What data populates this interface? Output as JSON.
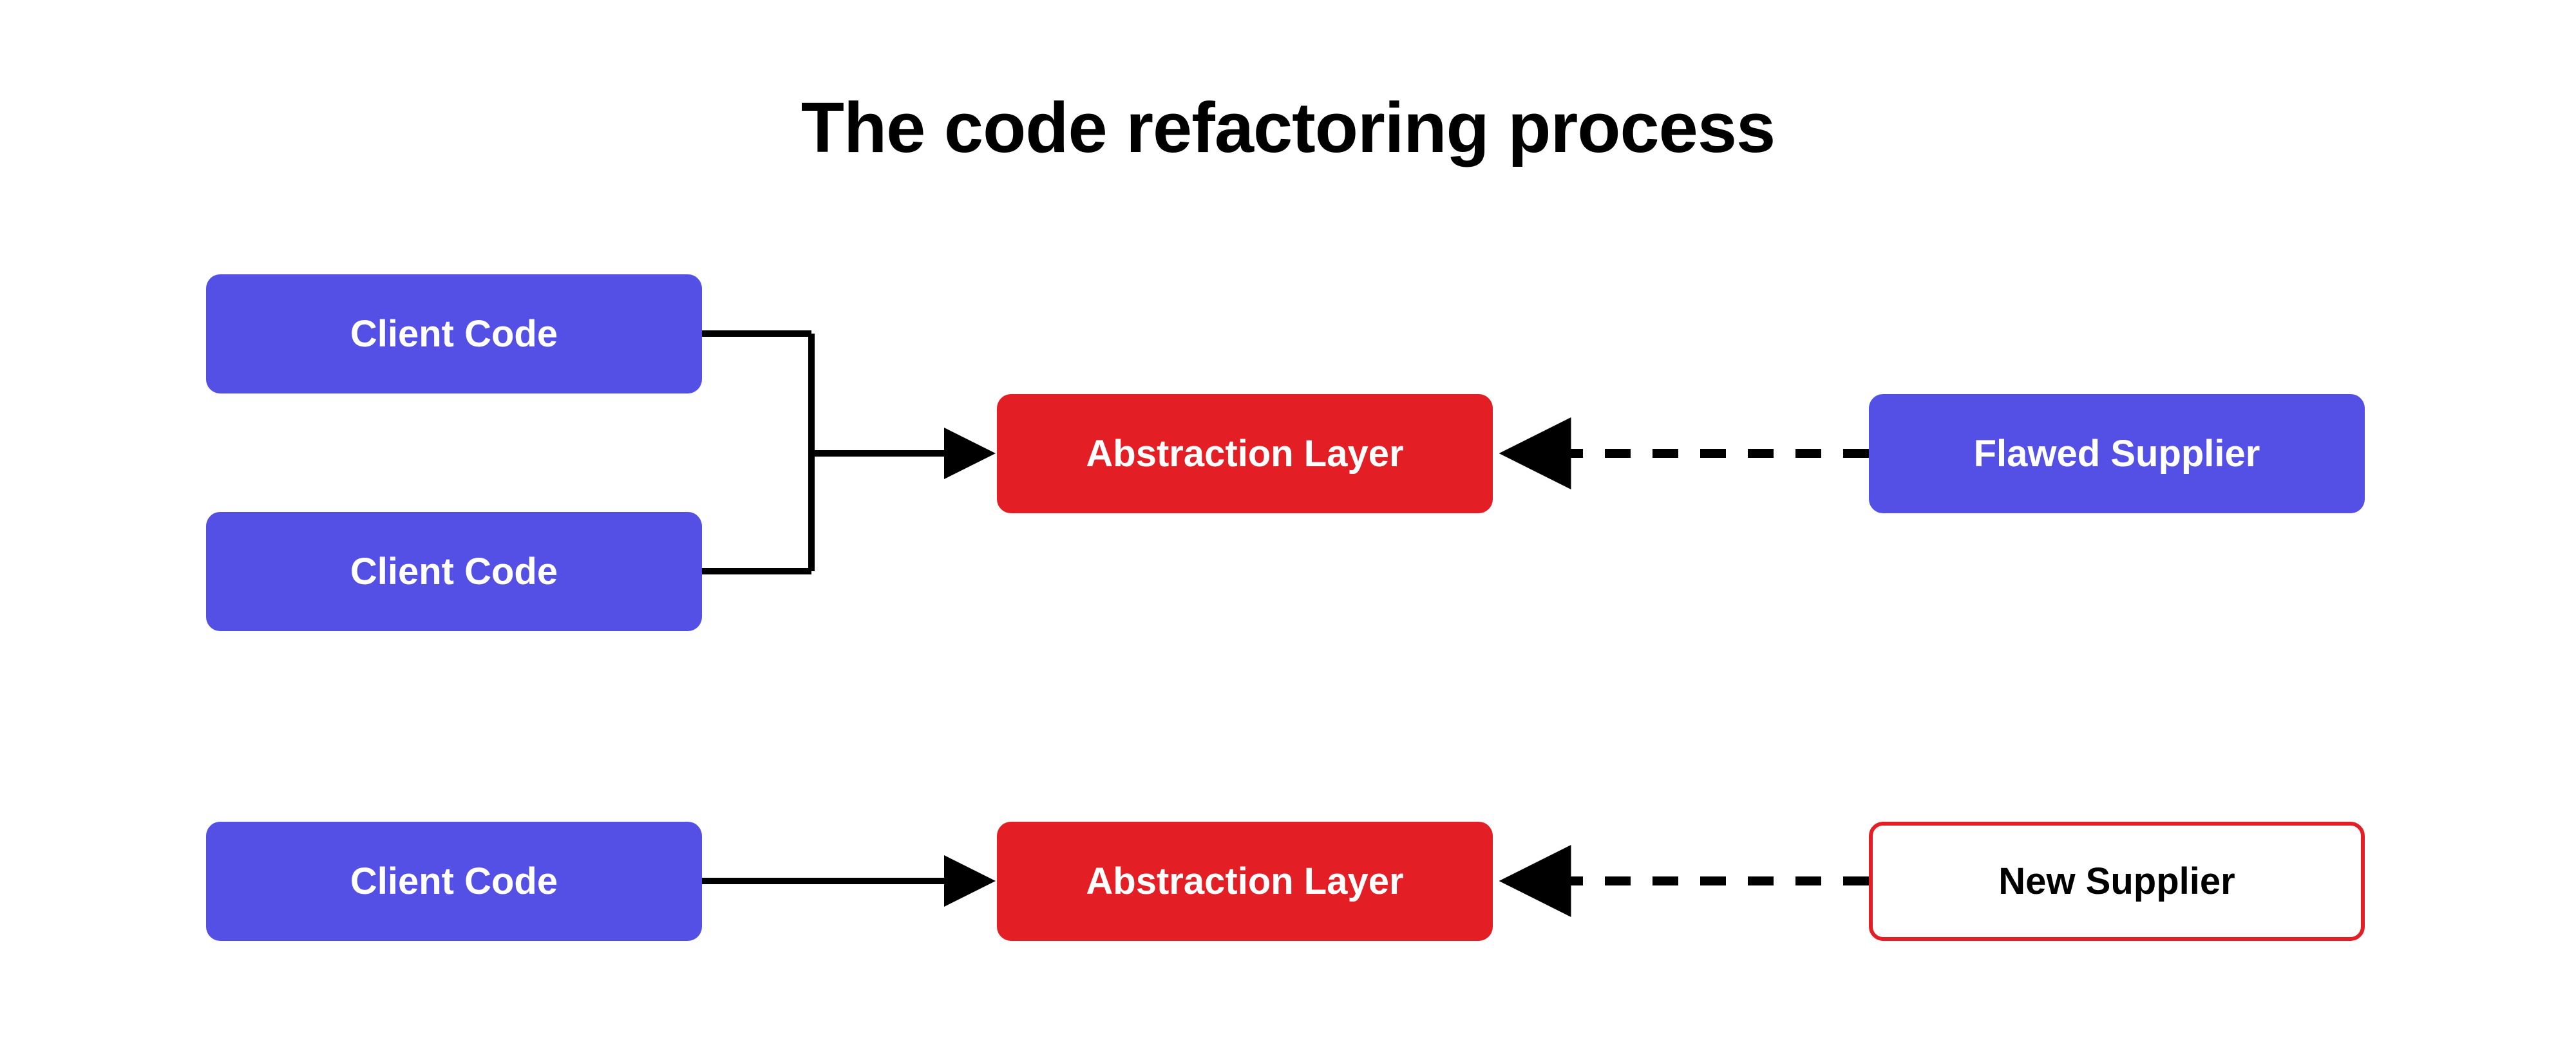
{
  "title": "The code refactoring process",
  "boxes": {
    "client1": "Client Code",
    "client2": "Client Code",
    "client3": "Client Code",
    "abstraction1": "Abstraction Layer",
    "abstraction2": "Abstraction Layer",
    "flawed_supplier": "Flawed Supplier",
    "new_supplier": "New Supplier"
  },
  "colors": {
    "purple": "#5450E5",
    "red": "#E31E24",
    "black": "#000000"
  }
}
